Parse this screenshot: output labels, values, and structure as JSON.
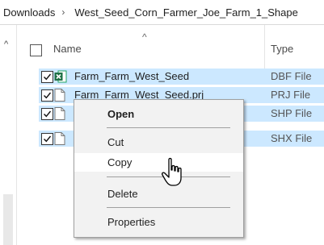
{
  "breadcrumb": {
    "parts": [
      "Downloads",
      "West_Seed_Corn_Farmer_Joe_Farm_1_Shape"
    ],
    "separator": "›"
  },
  "header": {
    "name_label": "Name",
    "type_label": "Type",
    "sort_indicator": "^"
  },
  "files": [
    {
      "name": "Farm_Farm_West_Seed",
      "type": "DBF File",
      "icon": "excel-file-icon"
    },
    {
      "name": "Farm_Farm_West_Seed.prj",
      "type": "PRJ File",
      "icon": "generic-file-icon"
    },
    {
      "name": "",
      "type": "SHP File",
      "icon": "generic-file-icon"
    },
    {
      "name": "",
      "type": "SHX File",
      "icon": "generic-file-icon"
    }
  ],
  "context_menu": {
    "items": [
      "Open",
      "Cut",
      "Copy",
      "Delete",
      "Properties"
    ],
    "hovered": "Copy"
  },
  "colors": {
    "selection": "#cce8ff",
    "menu_bg": "#f2f2f2",
    "excel_green": "#1e7145"
  }
}
